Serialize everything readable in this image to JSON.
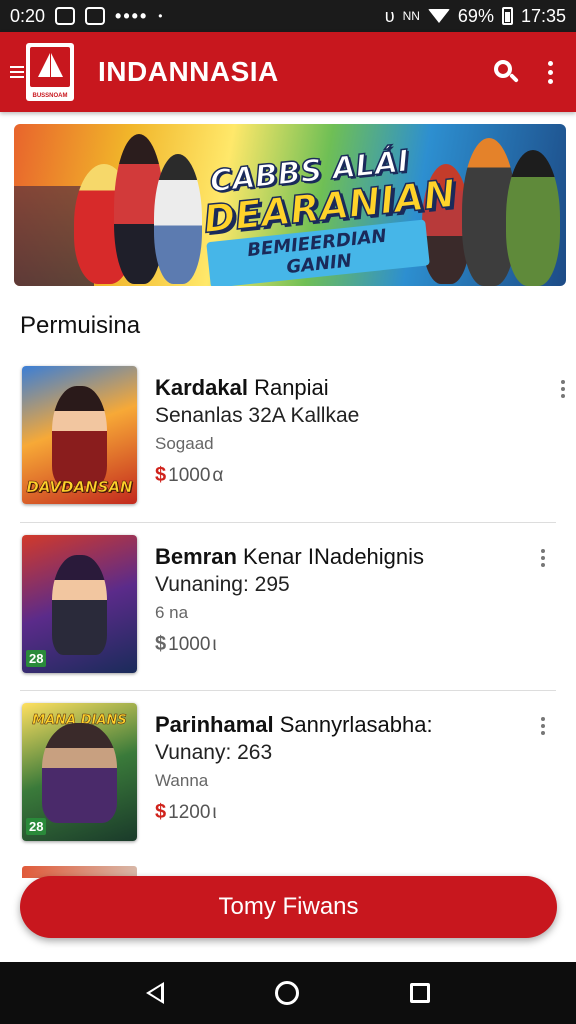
{
  "status_bar": {
    "time_left": "0:20",
    "icon_box_1": "■",
    "icon_box_2": "▬",
    "dots": "••••",
    "dot_single": "•",
    "alarm": "υ",
    "signal": "NN",
    "battery_percent": "69%",
    "time_right": "17:35"
  },
  "app_bar": {
    "title": "INDANNASIA",
    "logo_text": "BUSSNOAM"
  },
  "banner": {
    "line1": "CABBS ALÁI",
    "line2": "DEARANIAN",
    "line3": "BEMIEERDIAN GANIN"
  },
  "section": {
    "title": "Permuisina"
  },
  "items": [
    {
      "title_bold": "Kardakal",
      "title_rest": " Ranpiai",
      "subtitle": "Senanlas 32A Kallkae",
      "meta": "Sogaad",
      "price_symbol": "$",
      "price": "1000",
      "price_suffix": "α",
      "thumb_caption": "DAVDANSAN",
      "thumb_badge": ""
    },
    {
      "title_bold": "Bemran",
      "title_rest": " Kenar INadehignis",
      "subtitle": "Vunaning: 295",
      "meta": "6 na",
      "price_symbol": "$",
      "price": "1000",
      "price_suffix": "ι",
      "thumb_caption": "",
      "thumb_badge": "28"
    },
    {
      "title_bold": "Parinhamal",
      "title_rest": " Sannyrlasabha:",
      "subtitle": "Vunany: 263",
      "meta": "Wanna",
      "price_symbol": "$",
      "price": "1200",
      "price_suffix": "ι",
      "thumb_caption": "MANA DIANS",
      "thumb_badge": "28"
    }
  ],
  "cta": {
    "label": "Tomy Fiwans"
  },
  "colors": {
    "brand_red": "#c8171e",
    "status_bar": "#1b1b1b",
    "nav_bar": "#0d0d0d"
  }
}
